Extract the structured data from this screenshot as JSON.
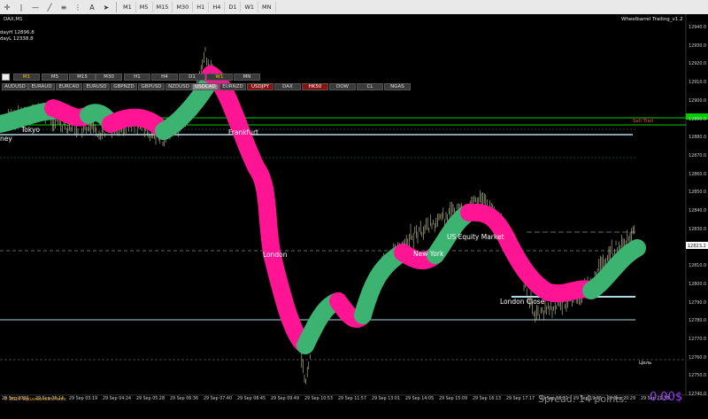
{
  "toolbar": {
    "timeframes": [
      "M1",
      "M5",
      "M15",
      "M30",
      "H1",
      "H4",
      "D1",
      "W1",
      "MN"
    ]
  },
  "chart": {
    "symbol_label": "DAX,M1",
    "day_high": "dayH 12896.8",
    "day_low": "dayL 12338.8",
    "indicator_name": "Wheelbarrel Trailing_v1.2",
    "spread": "Spread: 14 points.",
    "profit": "0.00$",
    "copyright": "© 2020 TopLessons.In/Forex",
    "sell_label": "Sell Trail",
    "target_label": "Цель",
    "price_box": "12823.2",
    "sessions": [
      "ney",
      "Tokyo",
      "Frankfurt",
      "London",
      "New York",
      "US Equity Market",
      "London Close"
    ]
  },
  "panel": {
    "timeframes": [
      "M1",
      "M5",
      "M15",
      "M30",
      "H1",
      "H4",
      "D1",
      "W1",
      "MN"
    ],
    "symbols": [
      "AUDUSD",
      "EURAUD",
      "EURCAD",
      "EURUSD",
      "GBPNZD",
      "GBPUSD",
      "NZDUSD",
      "USDCAD",
      "EURNZD",
      "USDJPY",
      "DAX",
      "HK50",
      "DOW",
      "CL",
      "NGAS"
    ]
  },
  "axis": {
    "price_ticks": [
      "12940.0",
      "12930.0",
      "12920.0",
      "12910.0",
      "12900.0",
      "12890.0",
      "12880.0",
      "12870.0",
      "12860.0",
      "12850.0",
      "12840.0",
      "12830.0",
      "12820.0",
      "12810.0",
      "12800.0",
      "12790.0",
      "12780.0",
      "12770.0",
      "12760.0",
      "12750.0",
      "12740.0"
    ],
    "time_ticks": [
      "29 Sep 2020",
      "29 Sep 02:14",
      "29 Sep 03:19",
      "29 Sep 04:24",
      "29 Sep 05:28",
      "29 Sep 06:36",
      "29 Sep 07:40",
      "29 Sep 08:45",
      "29 Sep 09:49",
      "29 Sep 10:53",
      "29 Sep 11:57",
      "29 Sep 13:01",
      "29 Sep 14:05",
      "29 Sep 15:09",
      "29 Sep 16:13",
      "29 Sep 17:17",
      "29 Sep 18:21",
      "29 Sep 19:25",
      "29 Sep 20:29",
      "29 Sep 21:33"
    ]
  },
  "colors": {
    "green": "#3cb371",
    "pink": "#ff1493",
    "bg": "#000000"
  }
}
